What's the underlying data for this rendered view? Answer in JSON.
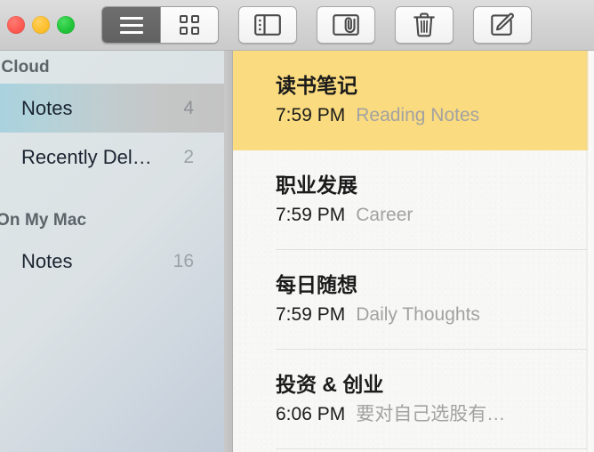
{
  "window": {
    "traffic_lights": [
      {
        "name": "close",
        "color": "#fc5b53"
      },
      {
        "name": "minimize",
        "color": "#fcbf2d"
      },
      {
        "name": "zoom",
        "color": "#22c43a"
      }
    ]
  },
  "toolbar": {
    "view_segments": [
      {
        "id": "list-view",
        "icon": "list-view-icon",
        "selected": true
      },
      {
        "id": "grid-view",
        "icon": "grid-view-icon",
        "selected": false
      }
    ],
    "buttons": [
      {
        "id": "toggle-sidebar",
        "icon": "sidebar-toggle-icon"
      },
      {
        "id": "attachments",
        "icon": "attachment-browser-icon"
      },
      {
        "id": "delete-note",
        "icon": "trash-icon"
      },
      {
        "id": "new-note",
        "icon": "compose-icon"
      }
    ]
  },
  "sidebar": {
    "sections": [
      {
        "header": "iCloud",
        "rows": [
          {
            "label": "Notes",
            "count": "4",
            "selected": true
          },
          {
            "label": "Recently Del…",
            "count": "2",
            "selected": false
          }
        ]
      },
      {
        "header": "On My Mac",
        "rows": [
          {
            "label": "Notes",
            "count": "16",
            "selected": false
          }
        ]
      }
    ]
  },
  "notes_list": {
    "items": [
      {
        "title": "读书笔记",
        "time": "7:59 PM",
        "snippet": "Reading Notes",
        "selected": true
      },
      {
        "title": "职业发展",
        "time": "7:59 PM",
        "snippet": "Career",
        "selected": false
      },
      {
        "title": "每日随想",
        "time": "7:59 PM",
        "snippet": "Daily Thoughts",
        "selected": false
      },
      {
        "title": "投资 & 创业",
        "time": "6:06 PM",
        "snippet": "要对自己选股有…",
        "selected": false
      }
    ]
  },
  "colors": {
    "selected_note": "#fadb7f",
    "sidebar_selection_left": "#a9d2de",
    "sidebar_selection_right": "#c3c3c3",
    "list_background": "#f7f7f5"
  }
}
